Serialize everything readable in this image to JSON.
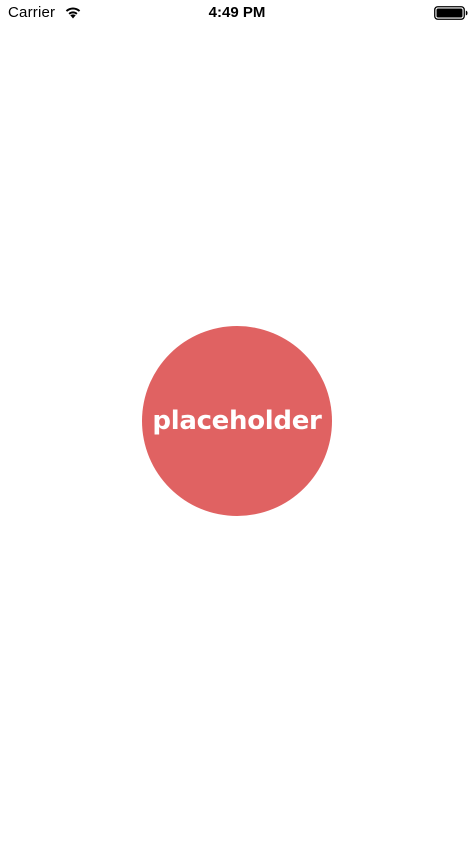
{
  "status_bar": {
    "carrier": "Carrier",
    "time": "4:49 PM",
    "wifi_icon": "wifi-icon",
    "battery_icon": "battery-icon"
  },
  "main": {
    "placeholder_label": "placeholder",
    "placeholder_color": "#e06262"
  }
}
